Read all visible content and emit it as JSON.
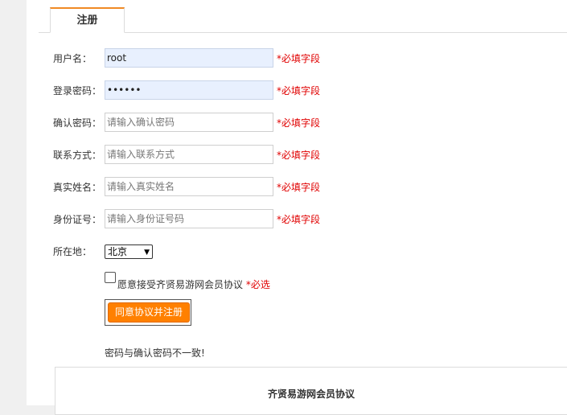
{
  "tabs": [
    {
      "label": "注册",
      "active": true
    }
  ],
  "form": {
    "username": {
      "label": "用户名：",
      "value": "root",
      "placeholder": "",
      "required_note": "*必填字段"
    },
    "password": {
      "label": "登录密码：",
      "value": "••••••",
      "placeholder": "",
      "required_note": "*必填字段"
    },
    "confirm_password": {
      "label": "确认密码：",
      "value": "",
      "placeholder": "请输入确认密码",
      "required_note": "*必填字段"
    },
    "contact": {
      "label": "联系方式：",
      "value": "",
      "placeholder": "请输入联系方式",
      "required_note": "*必填字段"
    },
    "real_name": {
      "label": "真实姓名：",
      "value": "",
      "placeholder": "请输入真实姓名",
      "required_note": "*必填字段"
    },
    "id_number": {
      "label": "身份证号：",
      "value": "",
      "placeholder": "请输入身份证号码",
      "required_note": "*必填字段"
    },
    "location": {
      "label": "所在地：",
      "selected": "北京"
    }
  },
  "agreement_check": {
    "checked": false,
    "text": "愿意接受齐贤易游网会员协议",
    "required_note": "*必选"
  },
  "submit_button": {
    "label": "同意协议并注册"
  },
  "validation_message": "密码与确认密码不一致!",
  "agreement_panel": {
    "title": "齐贤易游网会员协议"
  },
  "colors": {
    "accent": "#ff8000",
    "required": "#e00000",
    "autofill_bg": "#e8f0fe"
  }
}
